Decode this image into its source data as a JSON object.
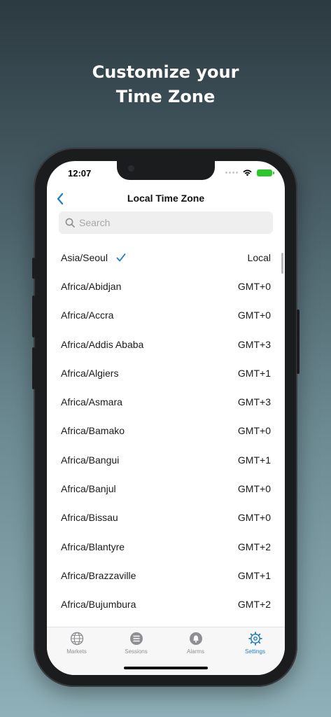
{
  "headline": {
    "line1": "Customize your",
    "line2": "Time Zone"
  },
  "status_bar": {
    "time": "12:07"
  },
  "nav": {
    "title": "Local Time Zone"
  },
  "search": {
    "placeholder": "Search",
    "value": ""
  },
  "timezones": [
    {
      "name": "Asia/Seoul",
      "offset": "Local",
      "selected": true
    },
    {
      "name": "Africa/Abidjan",
      "offset": "GMT+0"
    },
    {
      "name": "Africa/Accra",
      "offset": "GMT+0"
    },
    {
      "name": "Africa/Addis Ababa",
      "offset": "GMT+3"
    },
    {
      "name": "Africa/Algiers",
      "offset": "GMT+1"
    },
    {
      "name": "Africa/Asmara",
      "offset": "GMT+3"
    },
    {
      "name": "Africa/Bamako",
      "offset": "GMT+0"
    },
    {
      "name": "Africa/Bangui",
      "offset": "GMT+1"
    },
    {
      "name": "Africa/Banjul",
      "offset": "GMT+0"
    },
    {
      "name": "Africa/Bissau",
      "offset": "GMT+0"
    },
    {
      "name": "Africa/Blantyre",
      "offset": "GMT+2"
    },
    {
      "name": "Africa/Brazzaville",
      "offset": "GMT+1"
    },
    {
      "name": "Africa/Bujumbura",
      "offset": "GMT+2"
    }
  ],
  "tabs": [
    {
      "label": "Markets",
      "icon": "globe-icon"
    },
    {
      "label": "Sessions",
      "icon": "list-icon"
    },
    {
      "label": "Alarms",
      "icon": "bell-icon"
    },
    {
      "label": "Settings",
      "icon": "gear-icon",
      "active": true
    }
  ],
  "colors": {
    "accent": "#1c7ec5",
    "battery": "#2fc52f"
  }
}
